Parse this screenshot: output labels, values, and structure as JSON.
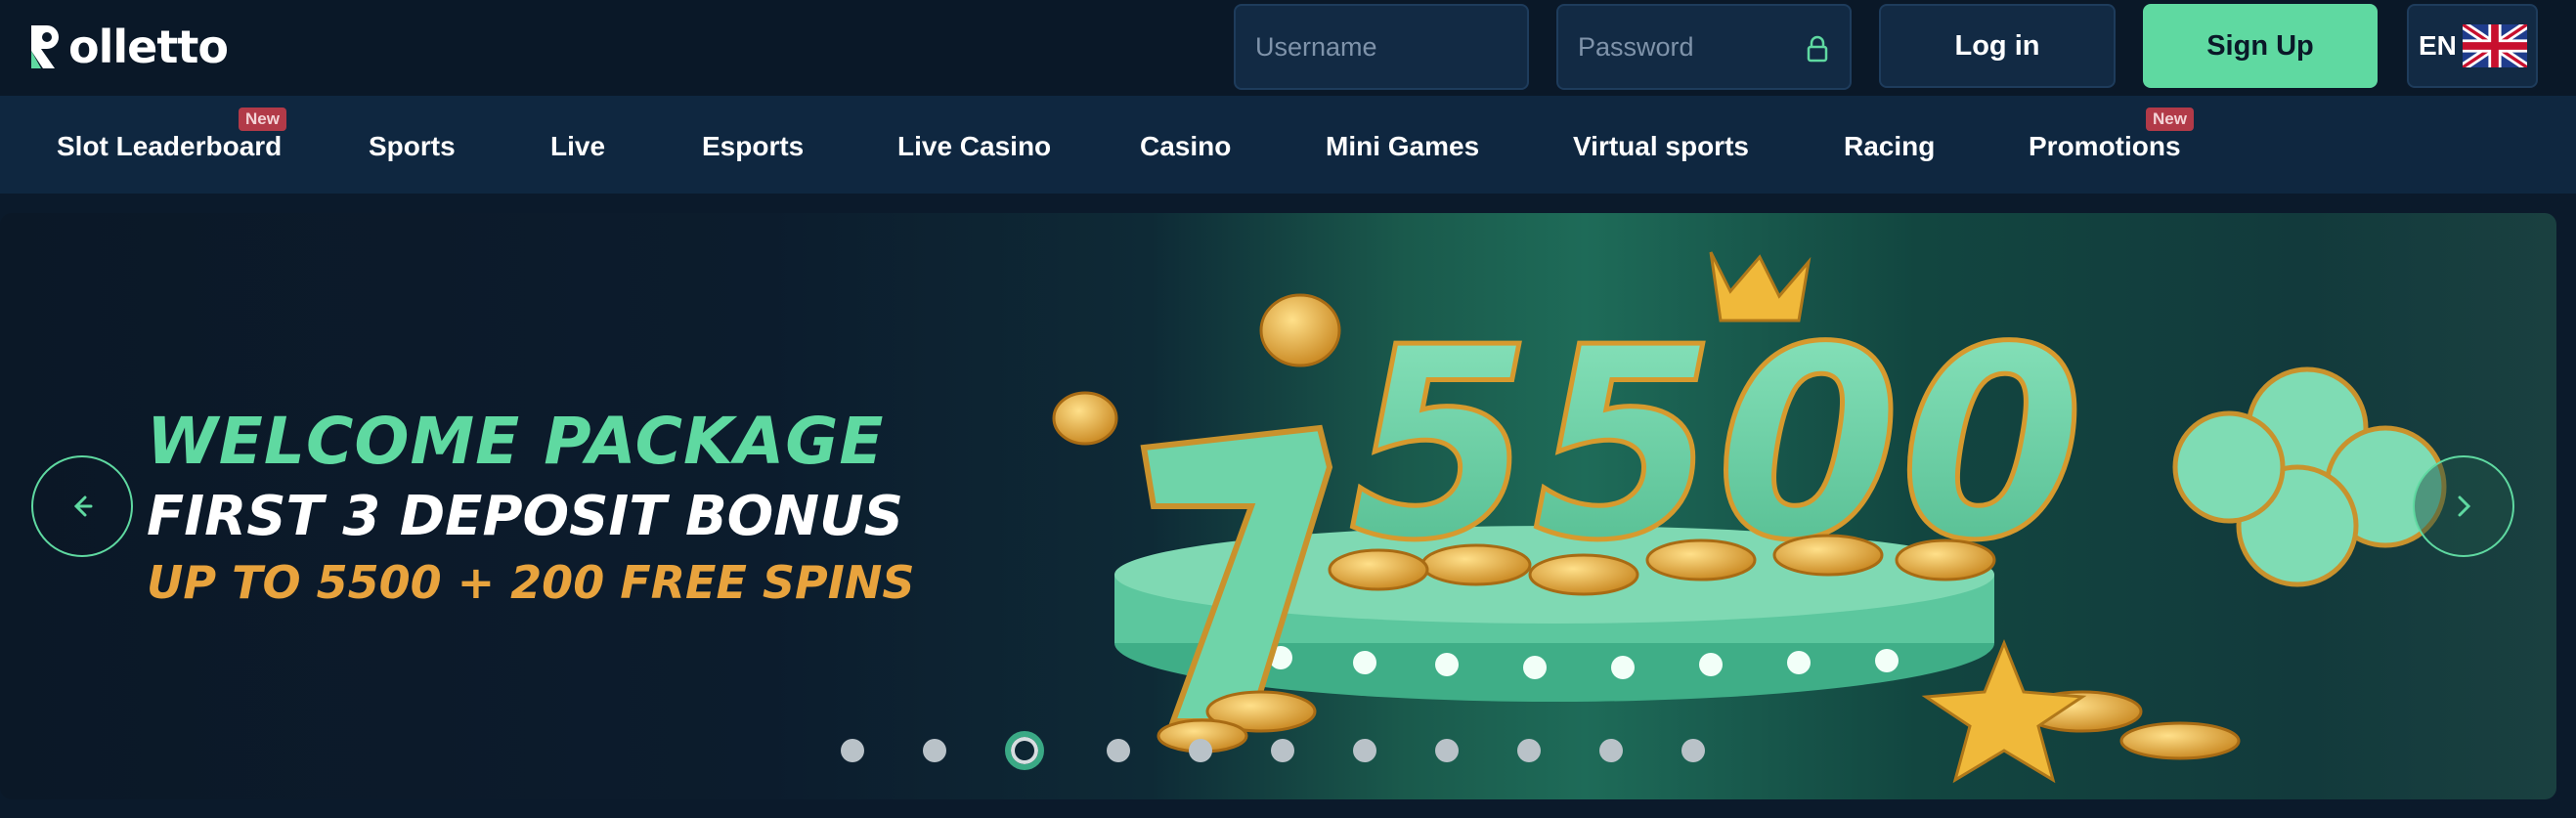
{
  "header": {
    "logo_text": "olletto",
    "username_placeholder": "Username",
    "password_placeholder": "Password",
    "login_label": "Log in",
    "signup_label": "Sign Up",
    "language": "EN"
  },
  "nav": {
    "items": [
      {
        "label": "Slot Leaderboard",
        "badge": "New"
      },
      {
        "label": "Sports"
      },
      {
        "label": "Live"
      },
      {
        "label": "Esports"
      },
      {
        "label": "Live Casino"
      },
      {
        "label": "Casino"
      },
      {
        "label": "Mini Games"
      },
      {
        "label": "Virtual sports"
      },
      {
        "label": "Racing"
      },
      {
        "label": "Promotions",
        "badge": "New"
      }
    ]
  },
  "hero": {
    "line1": "WELCOME PACKAGE",
    "line2": "FIRST 3 DEPOSIT BONUS",
    "line3": "UP TO 5500 + 200 FREE SPINS",
    "art_number": "5500",
    "slide_count": 11,
    "active_slide": 3
  },
  "colors": {
    "accent": "#5fd9a1",
    "gold": "#e8a33d",
    "badge": "#b23a48",
    "bg": "#0a1828"
  }
}
